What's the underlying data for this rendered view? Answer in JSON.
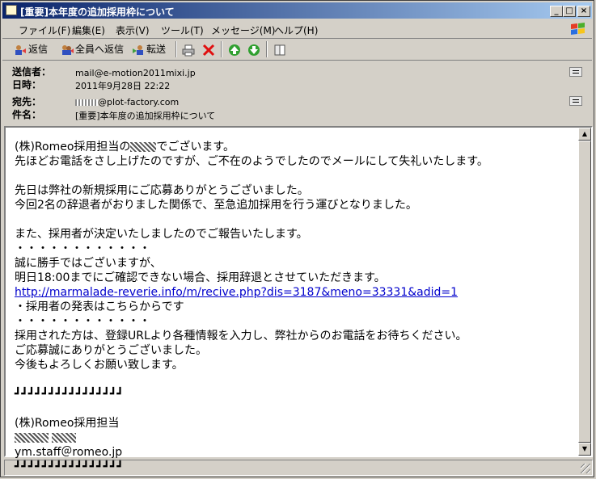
{
  "window": {
    "title": "[重要]本年度の追加採用枠について",
    "min_glyph": "_",
    "max_glyph": "□",
    "close_glyph": "×"
  },
  "menu": [
    "ファイル(F)",
    "編集(E)",
    "表示(V)",
    "ツール(T)",
    "メッセージ(M)",
    "ヘルプ(H)"
  ],
  "toolbar": {
    "reply": "返信",
    "reply_all": "全員へ返信",
    "forward": "転送"
  },
  "headers": {
    "from_label": "送信者：",
    "from_value": "mail@e-motion2011mixi.jp",
    "date_label": "日時：",
    "date_value": "2011年9月28日 22:22",
    "to_label": "宛先：",
    "to_value": "@plot-factory.com",
    "subject_label": "件名：",
    "subject_value": "[重要]本年度の追加採用枠について"
  },
  "message": {
    "l01": "(株)Romeo採用担当の",
    "l01b": "でございます。",
    "l02": "先ほどお電話をさし上げたのですが、ご不在のようでしたのでメールにして失礼いたします。",
    "l04": "先日は弊社の新規採用にご応募ありがとうございました。",
    "l05": "今回2名の辞退者がおりました関係で、至急追加採用を行う運びとなりました。",
    "l07": "また、採用者が決定いたしましたのでご報告いたします。",
    "l08": "・・・・・・・・・・・・",
    "l09": "誠に勝手ではございますが、",
    "l10": "明日18:00までにご確認できない場合、採用辞退とさせていただきます。",
    "link": "http://marmalade-reverie.info/m/recive.php?dis=3187&meno=33331&adid=1",
    "l12": "・採用者の発表はこちらからです",
    "l13": "・・・・・・・・・・・・",
    "l14": "採用された方は、登録URLより各種情報を入力し、弊社からのお電話をお待ちください。",
    "l15": "ご応募誠にありがとうございました。",
    "l16": "今後もよろしくお願い致します。",
    "l18": "┛┛┛┛┛┛┛┛┛┛┛┛┛┛┛┛",
    "l20": "(株)Romeo採用担当",
    "l22": "ym.staff＠romeo.jp",
    "l23": "┛┛┛┛┛┛┛┛┛┛┛┛┛┛┛┛"
  }
}
